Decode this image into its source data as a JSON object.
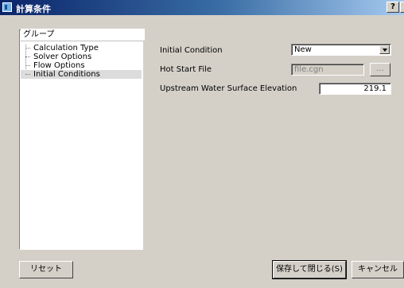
{
  "window": {
    "title": "計算条件",
    "help_label": "?",
    "close_label": "×"
  },
  "group": {
    "title": "グループ",
    "items": [
      {
        "label": "Calculation Type"
      },
      {
        "label": "Solver Options"
      },
      {
        "label": "Flow Options"
      },
      {
        "label": "Initial Conditions",
        "selected": true
      }
    ]
  },
  "form": {
    "initial_condition_label": "Initial Condition",
    "initial_condition_value": "New",
    "hot_start_label": "Hot Start File",
    "hot_start_value": "file.cgn",
    "browse_label": "...",
    "upstream_label": "Upstream Water Surface Elevation",
    "upstream_value": "219.1"
  },
  "buttons": {
    "reset": "リセット",
    "save_close": "保存して閉じる(S)",
    "cancel": "キャンセル"
  }
}
